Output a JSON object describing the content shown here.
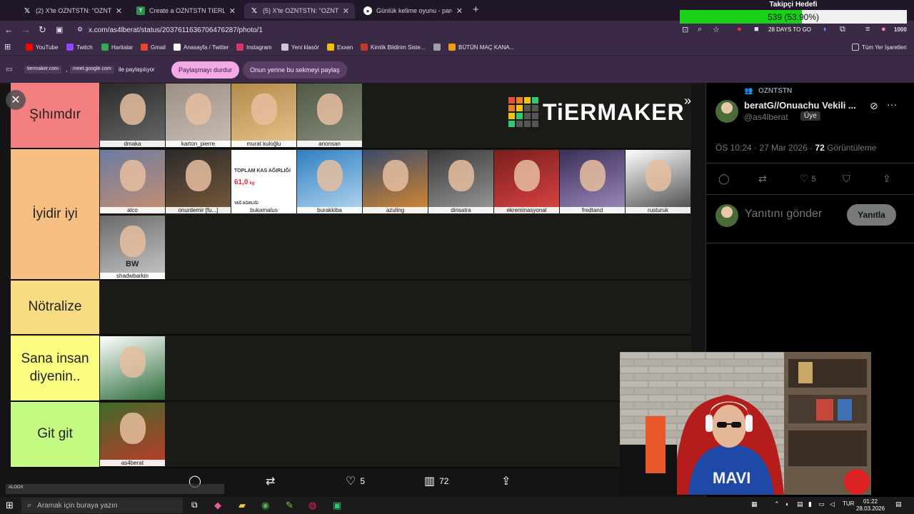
{
  "browser": {
    "tabs": [
      {
        "title": "(2) X'te OZNTSTN: \"OZNTSTN",
        "icon": "x-logo-icon",
        "active": false
      },
      {
        "title": "Create a OZNTSTN TIERLIST",
        "icon": "tiermaker-icon",
        "active": false
      },
      {
        "title": "(5) X'te OZNTSTN: \"OZNTSTN",
        "icon": "x-logo-icon",
        "active": true
      },
      {
        "title": "Günlük kelime oyunu - parolla",
        "icon": "globe-icon",
        "active": false
      }
    ],
    "url": "x.com/as4lberat/status/2037611636706476287/photo/1",
    "bookmarks": [
      {
        "label": "YouTube",
        "color": "#ff0000"
      },
      {
        "label": "Twitch",
        "color": "#9146ff"
      },
      {
        "label": "Haritalar",
        "color": "#34a853"
      },
      {
        "label": "Gmail",
        "color": "#ea4335"
      },
      {
        "label": "Anasayfa / Twitter",
        "color": "#ffffff"
      },
      {
        "label": "Instagram",
        "color": "#e1306c"
      },
      {
        "label": "Yeni klasör",
        "color": "#d0c6d8"
      },
      {
        "label": "Exxen",
        "color": "#f2c200"
      },
      {
        "label": "Kimlik Bildirim Siste...",
        "color": "#c0392b"
      },
      {
        "label": "",
        "color": "#9aa0a6"
      },
      {
        "label": "BÜTÜN MAÇ KANA...",
        "color": "#f39c12"
      }
    ],
    "all_bookmarks": "Tüm Yer İşaretleri",
    "share": {
      "chip1": "tiermaker.com",
      "chip2": "meet.google.com",
      "sharing_text": "ile paylaşılıyor",
      "stop_button": "Paylaşmayı durdur",
      "share_this_tab": "Onun yerine bu sekmeyi paylaş"
    },
    "extension_badge": "28 DAYS TO GO",
    "profile_count": "1000"
  },
  "tierlist": {
    "logo_text": "TiERMAKER",
    "tiers": [
      {
        "label": "Şıhımdır",
        "color": "#f47f80"
      },
      {
        "label": "İyidir iyi",
        "color": "#f7be82"
      },
      {
        "label": "Nötralize",
        "color": "#f8dc82"
      },
      {
        "label": "Sana insan diyenin..",
        "color": "#fbfd80"
      },
      {
        "label": "Git git",
        "color": "#c5fa82"
      }
    ],
    "images": [
      {
        "tier": 0,
        "caption": "dmaka"
      },
      {
        "tier": 0,
        "caption": "karton_pierre"
      },
      {
        "tier": 0,
        "caption": "murat kuloğlu"
      },
      {
        "tier": 0,
        "caption": "anonsan"
      },
      {
        "tier": 1,
        "caption": "alco"
      },
      {
        "tier": 1,
        "caption": "onurdemir [fu...]"
      },
      {
        "tier": 1,
        "caption": "bukamalus",
        "headline": "TOPLAM KAS AĞIRLIĞI",
        "value": "61,0",
        "unit": "kg",
        "sub": "YAĞ AĞIRLIĞI"
      },
      {
        "tier": 1,
        "caption": "burakkiba"
      },
      {
        "tier": 1,
        "caption": "azuling"
      },
      {
        "tier": 1,
        "caption": "dirisatra"
      },
      {
        "tier": 1,
        "caption": "ekreminasyonal"
      },
      {
        "tier": 1,
        "caption": "fredtand"
      },
      {
        "tier": 1,
        "caption": "rusturuk"
      },
      {
        "tier": 1,
        "caption": "shadwbarkin",
        "shirt_text": "BW"
      },
      {
        "tier": 3,
        "caption": ""
      },
      {
        "tier": 4,
        "caption": "as4berat"
      }
    ]
  },
  "photo_actions": {
    "likes": "5",
    "views": "72"
  },
  "tweet": {
    "community": "OZNTSTN",
    "display_name": "beratG//Onuachu Vekili ...",
    "handle": "@as4lberat",
    "member_badge": "Üye",
    "time": "ÖS 10:24 · 27 Mar 2026",
    "views": "72",
    "views_label": "Görüntüleme",
    "likes": "5",
    "reply_placeholder": "Yanıtını gönder",
    "reply_button": "Yanıtla"
  },
  "overlays": {
    "follower_goal_title": "Takipçi Hedefi",
    "follower_goal_text": "539 (53.90%)",
    "follower_goal_fraction": 0.539,
    "alert_label": "ALOOX"
  },
  "taskbar": {
    "search_placeholder": "Aramak için buraya yazın",
    "lang": "TUR",
    "time": "01:22",
    "date": "28.03.2026"
  }
}
